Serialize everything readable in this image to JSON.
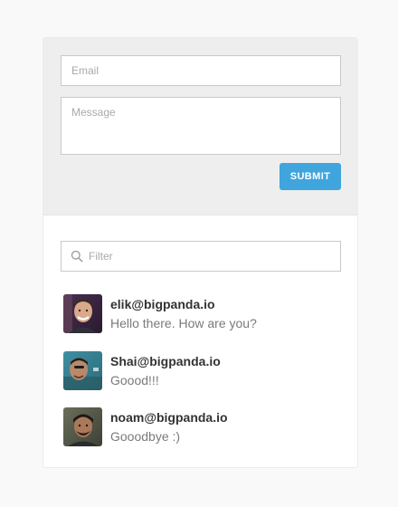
{
  "form": {
    "email_placeholder": "Email",
    "message_placeholder": "Message",
    "submit_label": "SUBMIT"
  },
  "filter": {
    "placeholder": "Filter",
    "icon": "search-icon"
  },
  "comments": [
    {
      "author": "elik@bigpanda.io",
      "body": "Hello there. How are you?",
      "avatar": "user-avatar-photo"
    },
    {
      "author": "Shai@bigpanda.io",
      "body": "Goood!!!",
      "avatar": "user-avatar-photo"
    },
    {
      "author": "noam@bigpanda.io",
      "body": "Gooodbye :)",
      "avatar": "user-avatar-photo"
    }
  ],
  "colors": {
    "accent": "#3fa5dc",
    "form_background": "#eeeeee",
    "page_background": "#f9f9f9",
    "author_text": "#333333",
    "body_text": "#7a7a7a"
  }
}
